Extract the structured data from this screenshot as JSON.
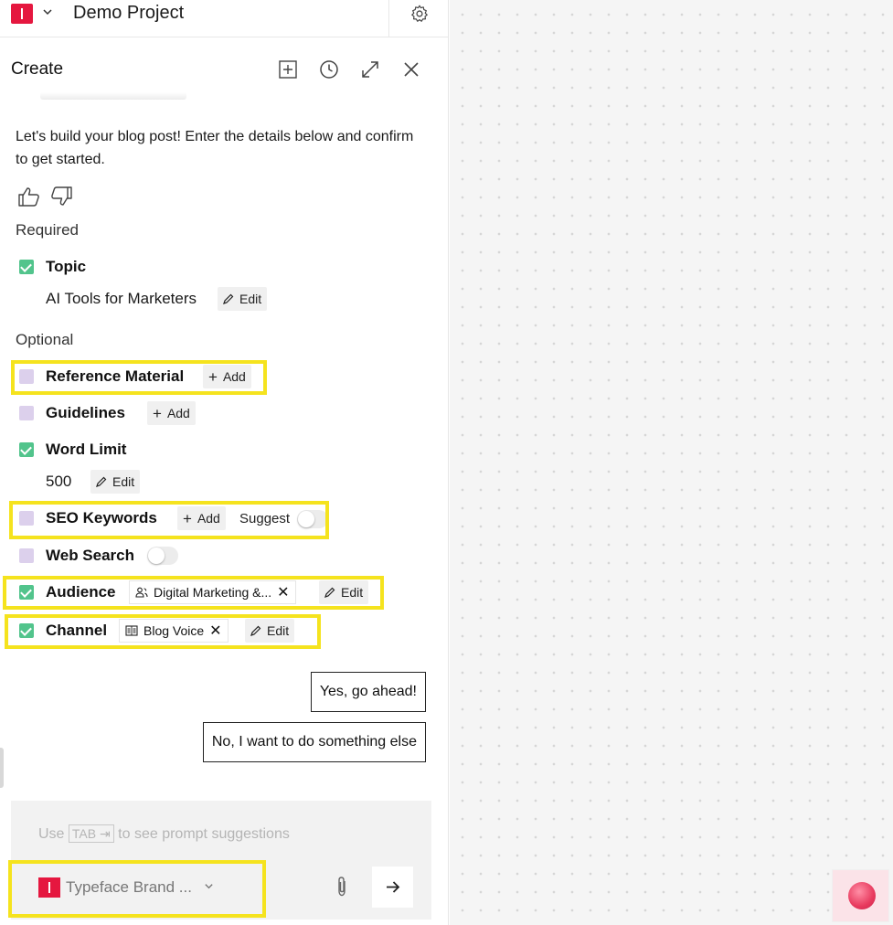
{
  "topbar": {
    "project_name": "Demo Project"
  },
  "header": {
    "title": "Create"
  },
  "chat": {
    "intro": "Let's build your blog post! Enter the details below and confirm to get started."
  },
  "form": {
    "required_label": "Required",
    "optional_label": "Optional",
    "topic": {
      "label": "Topic",
      "value": "AI Tools for Marketers",
      "edit": "Edit",
      "checked": true
    },
    "reference_material": {
      "label": "Reference Material",
      "add": "Add",
      "checked": false
    },
    "guidelines": {
      "label": "Guidelines",
      "add": "Add",
      "checked": false
    },
    "word_limit": {
      "label": "Word Limit",
      "value": "500",
      "edit": "Edit",
      "checked": true
    },
    "seo_keywords": {
      "label": "SEO Keywords",
      "add": "Add",
      "suggest": "Suggest",
      "checked": false
    },
    "web_search": {
      "label": "Web Search",
      "checked": false
    },
    "audience": {
      "label": "Audience",
      "tag": "Digital Marketing &...",
      "edit": "Edit",
      "checked": true
    },
    "channel": {
      "label": "Channel",
      "tag": "Blog Voice",
      "edit": "Edit",
      "checked": true
    }
  },
  "replies": {
    "yes": "Yes, go ahead!",
    "no": "No, I want to do something else"
  },
  "composer": {
    "hint_before": "Use",
    "hint_key": "TAB ⇥",
    "hint_after": "to see prompt suggestions",
    "brand": "Typeface Brand ..."
  },
  "colors": {
    "brand_red": "#e5173f",
    "check_green": "#52c48c",
    "unchecked_lavender": "#dcd0ec",
    "highlight_yellow": "#f5e31e"
  }
}
